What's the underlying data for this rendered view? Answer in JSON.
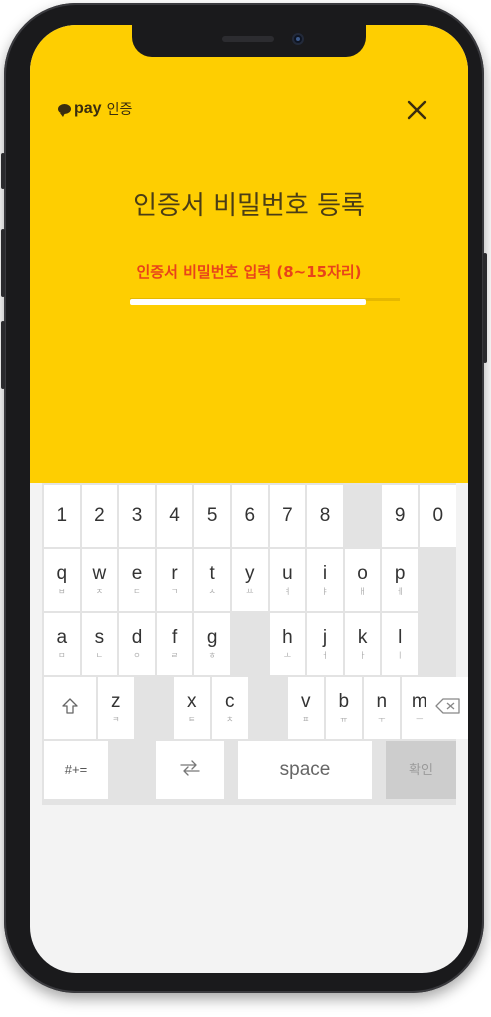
{
  "header": {
    "brand_name": "pay",
    "brand_sub": "인증",
    "close_icon": "close-icon"
  },
  "main": {
    "title": "인증서 비밀번호 등록",
    "guide": "인증서 비밀번호 입력 (8~15자리)"
  },
  "colors": {
    "accent_yellow": "#fece01",
    "guide_red": "#e8431a",
    "keyboard_bg": "#e3e3e3"
  },
  "keyboard": {
    "numbers": [
      "1",
      "2",
      "3",
      "4",
      "5",
      "6",
      "7",
      "8",
      "9",
      "0"
    ],
    "row1": [
      {
        "main": "q",
        "sub": "ㅂ"
      },
      {
        "main": "w",
        "sub": "ㅈ"
      },
      {
        "main": "e",
        "sub": "ㄷ"
      },
      {
        "main": "r",
        "sub": "ㄱ"
      },
      {
        "main": "t",
        "sub": "ㅅ"
      },
      {
        "main": "y",
        "sub": "ㅛ"
      },
      {
        "main": "u",
        "sub": "ㅕ"
      },
      {
        "main": "i",
        "sub": "ㅑ"
      },
      {
        "main": "o",
        "sub": "ㅐ"
      },
      {
        "main": "p",
        "sub": "ㅔ"
      }
    ],
    "row2": [
      {
        "main": "a",
        "sub": "ㅁ"
      },
      {
        "main": "s",
        "sub": "ㄴ"
      },
      {
        "main": "d",
        "sub": "ㅇ"
      },
      {
        "main": "f",
        "sub": "ㄹ"
      },
      {
        "main": "g",
        "sub": "ㅎ"
      },
      {
        "main": "h",
        "sub": "ㅗ"
      },
      {
        "main": "j",
        "sub": "ㅓ"
      },
      {
        "main": "k",
        "sub": "ㅏ"
      },
      {
        "main": "l",
        "sub": "ㅣ"
      }
    ],
    "row3": [
      {
        "main": "z",
        "sub": "ㅋ"
      },
      {
        "main": "x",
        "sub": "ㅌ"
      },
      {
        "main": "c",
        "sub": "ㅊ"
      },
      {
        "main": "v",
        "sub": "ㅍ"
      },
      {
        "main": "b",
        "sub": "ㅠ"
      },
      {
        "main": "n",
        "sub": "ㅜ"
      },
      {
        "main": "m",
        "sub": "ㅡ"
      }
    ],
    "symbols_label": "#+=",
    "space_label": "space",
    "confirm_label": "확인",
    "shift_icon": "shift-icon",
    "backspace_icon": "backspace-icon",
    "shuffle_icon": "shuffle-icon"
  }
}
